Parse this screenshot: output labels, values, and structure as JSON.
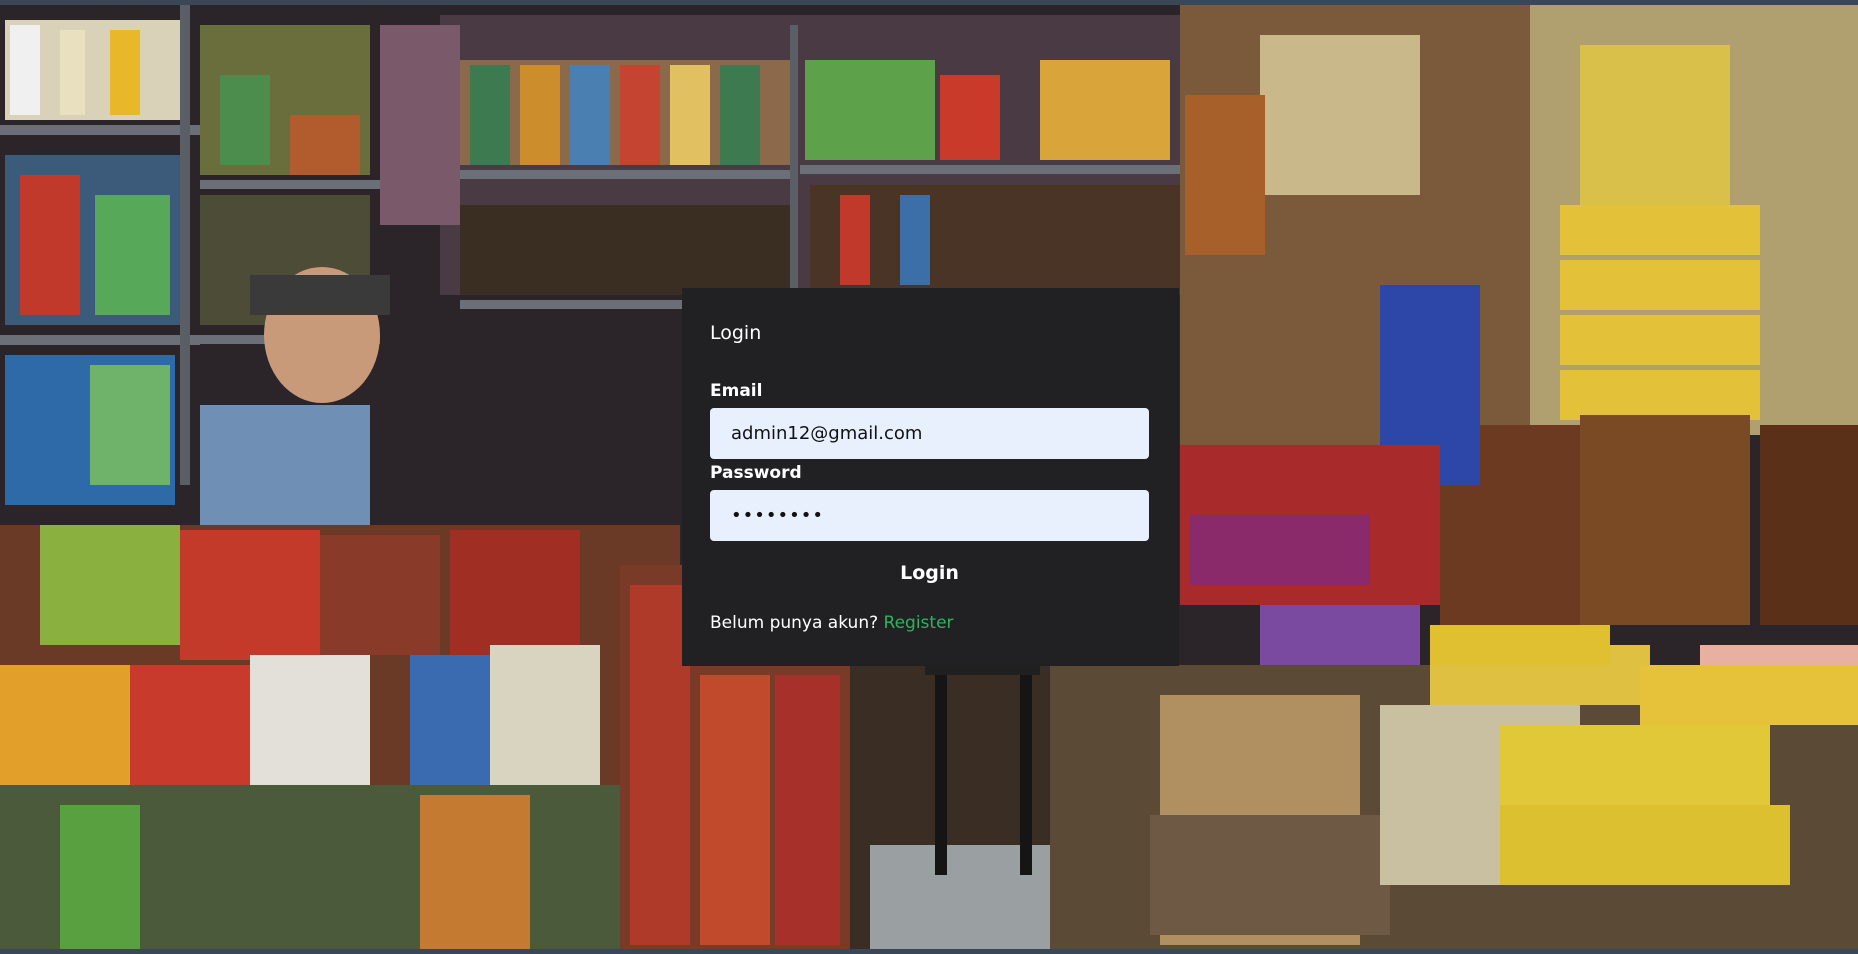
{
  "login": {
    "title": "Login",
    "email_label": "Email",
    "email_value": "admin12@gmail.com",
    "password_label": "Password",
    "password_value": "••••••••",
    "submit_label": "Login",
    "register_prompt": "Belum punya akun?",
    "register_link": "Register"
  },
  "colors": {
    "card_bg": "#212124",
    "input_bg": "#e8f0fe",
    "link": "#2fb35a"
  }
}
